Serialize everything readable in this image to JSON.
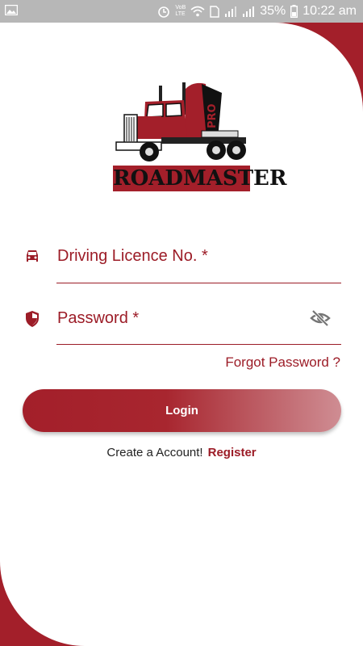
{
  "status_bar": {
    "carrier_small_top": "VoB",
    "carrier_small_bottom": "LTE",
    "battery_percent": "35%",
    "time": "10:22 am"
  },
  "logo": {
    "brand_text": "ROADMASTER",
    "badge_text": "PRO"
  },
  "form": {
    "licence_label": "Driving Licence No. *",
    "password_label": "Password *",
    "forgot_password": "Forgot Password ?",
    "login_button": "Login"
  },
  "footer": {
    "create_account_text": "Create a Account!",
    "register_link": "Register"
  },
  "colors": {
    "brand": "#a31f2a",
    "status_bar": "#b7b7b7"
  }
}
